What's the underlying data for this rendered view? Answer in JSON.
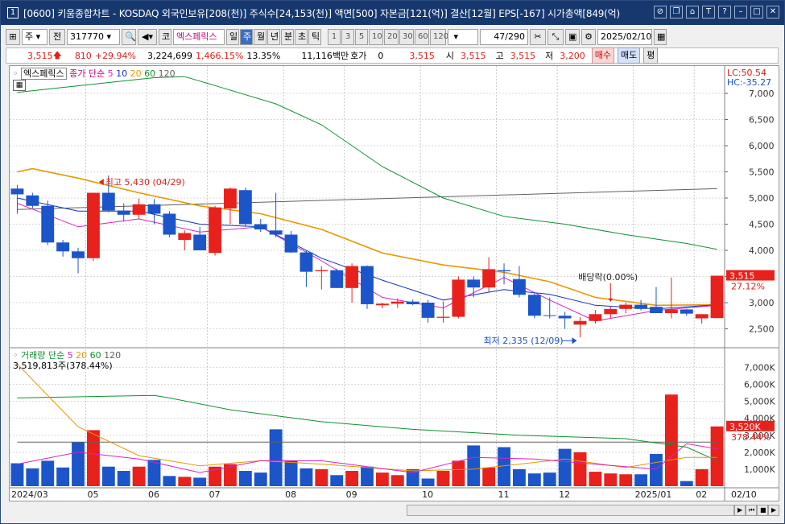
{
  "title_bar": {
    "window_num": "1",
    "text": "[0600] 키움종합차트 - KOSDAQ 외국인보유[208(천)] 주식수[24,153(천)] 액면[500] 자본금[121(억)] 결산[12월] EPS[-167] 시가총액[849(억)"
  },
  "toolbar": {
    "period_select": "주",
    "prev_label": "전",
    "code": "317770",
    "market_tag": "코",
    "stock_name": "엑스페릭스",
    "period_buttons": [
      "일",
      "주",
      "월",
      "년",
      "분",
      "초",
      "틱"
    ],
    "period_selected": "주",
    "interval_buttons": [
      "1",
      "3",
      "5",
      "10",
      "20",
      "30",
      "60",
      "120"
    ],
    "count": "47",
    "count_total": "/290",
    "date": "2025/02/10"
  },
  "quote": {
    "price": "3,515",
    "change": "810",
    "change_pct": "+29.94%",
    "volume": "3,224,699",
    "vol_ratio": "1,466.15%",
    "turnover": "13.35%",
    "amount": "11,116백만",
    "hoga_label": "호가",
    "hoga_value": "0",
    "hoga_price": "3,515",
    "open_label": "시",
    "open": "3,515",
    "high_label": "고",
    "high": "3,515",
    "low_label": "저",
    "low": "3,200",
    "buy_button": "매수",
    "sell_button": "매도",
    "eval_button": "평"
  },
  "price_legend": {
    "name": "엑스페릭스",
    "label": "종가 단순",
    "periods": [
      "5",
      "10",
      "20",
      "60",
      "120"
    ],
    "colors": [
      "#e020c0",
      "#1030c0",
      "#e89800",
      "#109030",
      "#606060"
    ]
  },
  "volume_legend": {
    "label": "거래량 단순",
    "periods": [
      "5",
      "20",
      "60",
      "120"
    ],
    "colors": [
      "#e020c0",
      "#e89800",
      "#109030",
      "#606060"
    ],
    "value": "3,519,813주(378.44%)"
  },
  "annotations": {
    "high": "최고 5,430 (04/29)",
    "low": "최저 2,335 (12/09)",
    "dividend": "배당락(0.00%)"
  },
  "price_axis_top": {
    "lc": "LC:50.54",
    "hc": "HC:-35.27"
  },
  "price_axis_ticks": [
    "7,000",
    "6,500",
    "6,000",
    "5,500",
    "5,000",
    "4,500",
    "4,000",
    "3,500",
    "3,000",
    "2,500"
  ],
  "price_last": {
    "value": "3,515",
    "pct": "27.12%"
  },
  "volume_axis_ticks": [
    "7,000K",
    "6,000K",
    "5,000K",
    "4,000K",
    "3,000K",
    "2,000K",
    "1,000K"
  ],
  "volume_last": {
    "value": "3,520K",
    "pct": "378.44%"
  },
  "x_labels": [
    "2024/03",
    "05",
    "06",
    "07",
    "08",
    "09",
    "10",
    "11",
    "12",
    "2025/01",
    "02"
  ],
  "x_right_label": "02/10",
  "colors": {
    "up": "#e8211c",
    "down": "#1b55c9",
    "title_bg": "#16386e"
  },
  "chart_data": {
    "type": "candlestick",
    "ylim": [
      2200,
      7400
    ],
    "volume_ylim": [
      0,
      7400
    ],
    "candles": [
      {
        "o": 5180,
        "h": 5250,
        "l": 4700,
        "c": 5070
      },
      {
        "o": 5050,
        "h": 5100,
        "l": 4800,
        "c": 4850
      },
      {
        "o": 4850,
        "h": 4950,
        "l": 4100,
        "c": 4150
      },
      {
        "o": 4150,
        "h": 4200,
        "l": 3880,
        "c": 3980
      },
      {
        "o": 3980,
        "h": 4050,
        "l": 3560,
        "c": 3850
      },
      {
        "o": 3850,
        "h": 5100,
        "l": 3800,
        "c": 5100
      },
      {
        "o": 5100,
        "h": 5430,
        "l": 4730,
        "c": 4760
      },
      {
        "o": 4760,
        "h": 4900,
        "l": 4550,
        "c": 4680
      },
      {
        "o": 4680,
        "h": 4990,
        "l": 4600,
        "c": 4880
      },
      {
        "o": 4880,
        "h": 4980,
        "l": 4500,
        "c": 4700
      },
      {
        "o": 4700,
        "h": 4750,
        "l": 4250,
        "c": 4300
      },
      {
        "o": 4200,
        "h": 4380,
        "l": 4000,
        "c": 4330
      },
      {
        "o": 4300,
        "h": 4450,
        "l": 4000,
        "c": 4000
      },
      {
        "o": 3950,
        "h": 4850,
        "l": 3900,
        "c": 4820
      },
      {
        "o": 4800,
        "h": 5200,
        "l": 4500,
        "c": 5180
      },
      {
        "o": 5150,
        "h": 5200,
        "l": 4450,
        "c": 4500
      },
      {
        "o": 4500,
        "h": 4600,
        "l": 4350,
        "c": 4400
      },
      {
        "o": 4380,
        "h": 5100,
        "l": 4250,
        "c": 4300
      },
      {
        "o": 4300,
        "h": 4370,
        "l": 3950,
        "c": 3960
      },
      {
        "o": 3960,
        "h": 4000,
        "l": 3300,
        "c": 3590
      },
      {
        "o": 3600,
        "h": 3700,
        "l": 3250,
        "c": 3620
      },
      {
        "o": 3620,
        "h": 3650,
        "l": 3280,
        "c": 3280
      },
      {
        "o": 3280,
        "h": 3750,
        "l": 3000,
        "c": 3700
      },
      {
        "o": 3700,
        "h": 3710,
        "l": 2880,
        "c": 2970
      },
      {
        "o": 2950,
        "h": 3000,
        "l": 2890,
        "c": 2980
      },
      {
        "o": 2980,
        "h": 3080,
        "l": 2900,
        "c": 3020
      },
      {
        "o": 3020,
        "h": 3060,
        "l": 2950,
        "c": 2970
      },
      {
        "o": 3000,
        "h": 3050,
        "l": 2620,
        "c": 2710
      },
      {
        "o": 2710,
        "h": 3020,
        "l": 2620,
        "c": 2730
      },
      {
        "o": 2730,
        "h": 3500,
        "l": 2700,
        "c": 3440
      },
      {
        "o": 3440,
        "h": 3500,
        "l": 3100,
        "c": 3290
      },
      {
        "o": 3290,
        "h": 3870,
        "l": 3200,
        "c": 3640
      },
      {
        "o": 3620,
        "h": 3750,
        "l": 3350,
        "c": 3600
      },
      {
        "o": 3450,
        "h": 3700,
        "l": 3100,
        "c": 3150
      },
      {
        "o": 3150,
        "h": 3200,
        "l": 2700,
        "c": 2750
      },
      {
        "o": 2760,
        "h": 3100,
        "l": 2700,
        "c": 2750
      },
      {
        "o": 2750,
        "h": 2820,
        "l": 2500,
        "c": 2700
      },
      {
        "o": 2580,
        "h": 2720,
        "l": 2335,
        "c": 2650
      },
      {
        "o": 2650,
        "h": 2860,
        "l": 2600,
        "c": 2780
      },
      {
        "o": 2780,
        "h": 2920,
        "l": 2700,
        "c": 2880
      },
      {
        "o": 2880,
        "h": 3000,
        "l": 2800,
        "c": 2960
      },
      {
        "o": 2960,
        "h": 3050,
        "l": 2850,
        "c": 2880
      },
      {
        "o": 2920,
        "h": 3300,
        "l": 2850,
        "c": 2800
      },
      {
        "o": 2800,
        "h": 3480,
        "l": 2700,
        "c": 2870
      },
      {
        "o": 2870,
        "h": 2880,
        "l": 2750,
        "c": 2790
      },
      {
        "o": 2700,
        "h": 2760,
        "l": 2600,
        "c": 2780
      },
      {
        "o": 2705,
        "h": 3515,
        "l": 2700,
        "c": 3515
      }
    ],
    "volume": [
      1350,
      1050,
      1500,
      1100,
      2600,
      3300,
      1150,
      900,
      1150,
      1550,
      600,
      550,
      500,
      1150,
      1300,
      900,
      800,
      3350,
      1500,
      1050,
      1000,
      650,
      900,
      1150,
      800,
      650,
      1000,
      450,
      900,
      1500,
      2400,
      1100,
      2300,
      1000,
      750,
      800,
      2200,
      2000,
      850,
      750,
      700,
      700,
      1900,
      5400,
      300,
      1000,
      3520
    ],
    "ma_price": {
      "120": [
        [
          0,
          4780
        ],
        [
          46,
          5180
        ]
      ],
      "60": [
        [
          0,
          7020
        ],
        [
          9,
          7300
        ],
        [
          11,
          7320
        ],
        [
          13,
          7150
        ],
        [
          17,
          6800
        ],
        [
          20,
          6400
        ],
        [
          24,
          5600
        ],
        [
          28,
          5000
        ],
        [
          32,
          4650
        ],
        [
          36,
          4500
        ],
        [
          40,
          4300
        ],
        [
          44,
          4130
        ],
        [
          46,
          4020
        ]
      ],
      "20": [
        [
          0,
          5500
        ],
        [
          1,
          5560
        ],
        [
          4,
          5380
        ],
        [
          8,
          5100
        ],
        [
          12,
          4850
        ],
        [
          16,
          4700
        ],
        [
          20,
          4400
        ],
        [
          24,
          3950
        ],
        [
          28,
          3720
        ],
        [
          32,
          3580
        ],
        [
          35,
          3400
        ],
        [
          38,
          3100
        ],
        [
          42,
          2950
        ],
        [
          46,
          2960
        ]
      ],
      "10": [
        [
          0,
          5000
        ],
        [
          4,
          4750
        ],
        [
          8,
          4750
        ],
        [
          12,
          4500
        ],
        [
          16,
          4450
        ],
        [
          20,
          3850
        ],
        [
          24,
          3430
        ],
        [
          28,
          3050
        ],
        [
          32,
          3250
        ],
        [
          35,
          3160
        ],
        [
          38,
          2950
        ],
        [
          42,
          2880
        ],
        [
          46,
          2960
        ]
      ],
      "5": [
        [
          0,
          4900
        ],
        [
          4,
          4450
        ],
        [
          8,
          4600
        ],
        [
          12,
          4350
        ],
        [
          16,
          4450
        ],
        [
          20,
          3800
        ],
        [
          24,
          3100
        ],
        [
          28,
          2900
        ],
        [
          32,
          3480
        ],
        [
          35,
          3050
        ],
        [
          38,
          2650
        ],
        [
          42,
          2850
        ],
        [
          46,
          2950
        ]
      ]
    },
    "ma_volume": {
      "120": [
        [
          0,
          2600
        ],
        [
          46,
          2600
        ]
      ],
      "60": [
        [
          0,
          5200
        ],
        [
          9,
          5350
        ],
        [
          10,
          5200
        ],
        [
          14,
          4500
        ],
        [
          20,
          3800
        ],
        [
          26,
          3350
        ],
        [
          33,
          3000
        ],
        [
          40,
          2800
        ],
        [
          44,
          2300
        ],
        [
          46,
          1500
        ]
      ],
      "20": [
        [
          0,
          7200
        ],
        [
          4,
          3500
        ],
        [
          8,
          1800
        ],
        [
          12,
          1200
        ],
        [
          16,
          1500
        ],
        [
          20,
          1300
        ],
        [
          26,
          900
        ],
        [
          30,
          1000
        ],
        [
          36,
          1600
        ],
        [
          40,
          1100
        ],
        [
          44,
          1700
        ],
        [
          46,
          1700
        ]
      ],
      "5": [
        [
          0,
          1300
        ],
        [
          4,
          2000
        ],
        [
          8,
          1600
        ],
        [
          12,
          800
        ],
        [
          16,
          1500
        ],
        [
          20,
          1500
        ],
        [
          26,
          800
        ],
        [
          30,
          1700
        ],
        [
          34,
          1600
        ],
        [
          38,
          1300
        ],
        [
          42,
          1000
        ],
        [
          44,
          2500
        ],
        [
          46,
          2200
        ]
      ]
    }
  }
}
